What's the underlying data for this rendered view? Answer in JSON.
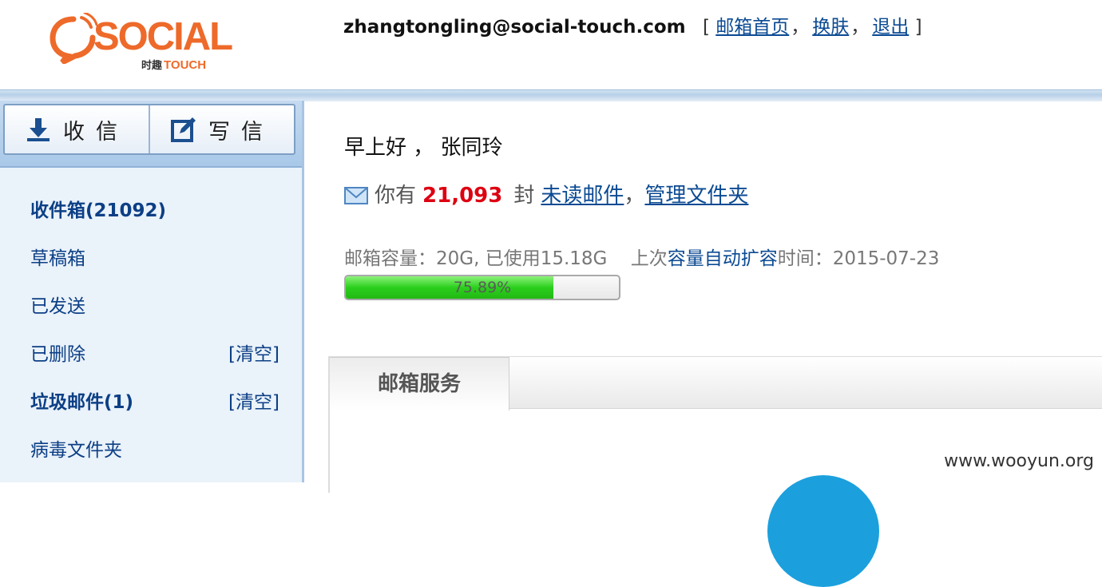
{
  "header": {
    "logo_text": "SOCIAL",
    "logo_sub_cn": "时趣",
    "logo_sub_en": "TOUCH",
    "user_email": "zhangtongling@social-touch.com",
    "bracket_open": "[",
    "bracket_close": "]",
    "links": [
      "邮箱首页",
      "换肤",
      "退出"
    ],
    "separator": "，"
  },
  "sidebar": {
    "receive_label": "收信",
    "compose_label": "写信",
    "folders": [
      {
        "label": "收件箱(21092)",
        "bold": true,
        "clear": null
      },
      {
        "label": "草稿箱",
        "bold": false,
        "clear": null
      },
      {
        "label": "已发送",
        "bold": false,
        "clear": null
      },
      {
        "label": "已删除",
        "bold": false,
        "clear": "[清空]"
      },
      {
        "label": "垃圾邮件(1)",
        "bold": true,
        "clear": "[清空]"
      },
      {
        "label": "病毒文件夹",
        "bold": false,
        "clear": null
      }
    ]
  },
  "main": {
    "greeting": "早上好 ， 张同玲",
    "you_have": "你有",
    "unread_count": "21,093",
    "feng": "封",
    "unread_link": "未读邮件",
    "comma": "，",
    "manage_link": "管理文件夹",
    "capacity_prefix": "邮箱容量：20G, 已使用15.18G",
    "capacity_mid_1": "上次",
    "capacity_auto": "容量自动扩容",
    "capacity_mid_2": "时间：2015-07-23",
    "progress_text": "75.89%",
    "progress_value": 0.7589,
    "tab_label": "邮箱服务"
  },
  "watermark": "www.wooyun.org",
  "colors": {
    "brand_orange": "#ee6a2a",
    "link_blue": "#0b4a93",
    "count_red": "#dd0011",
    "progress_green": "#2bcf1c"
  }
}
